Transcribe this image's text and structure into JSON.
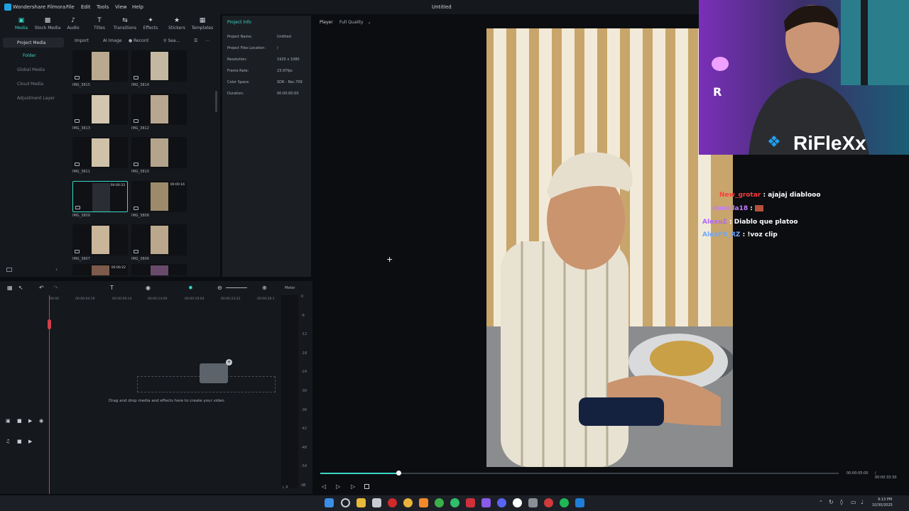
{
  "app": {
    "name": "Wondershare Filmora",
    "document_title": "Untitled",
    "menu": [
      "File",
      "Edit",
      "Tools",
      "View",
      "Help"
    ]
  },
  "toolbar": {
    "items": [
      {
        "label": "Media",
        "icon": "media-icon",
        "active": true
      },
      {
        "label": "Stock Media",
        "icon": "stock-media-icon"
      },
      {
        "label": "Audio",
        "icon": "audio-icon"
      },
      {
        "label": "Titles",
        "icon": "titles-icon"
      },
      {
        "label": "Transitions",
        "icon": "transitions-icon"
      },
      {
        "label": "Effects",
        "icon": "effects-icon"
      },
      {
        "label": "Stickers",
        "icon": "stickers-icon"
      },
      {
        "label": "Templates",
        "icon": "templates-icon"
      }
    ]
  },
  "leftnav": {
    "project_media": "Project Media",
    "folder": "Folder",
    "global_media": "Global Media",
    "cloud_media": "Cloud Media",
    "adjustment_layer": "Adjustment Layer"
  },
  "media_toolbar": {
    "import": "Import",
    "ai_image": "AI Image",
    "record": "Record",
    "search_placeholder": "Sea..."
  },
  "media_items": [
    {
      "name": "IMG_3815",
      "duration": ""
    },
    {
      "name": "IMG_3814",
      "duration": ""
    },
    {
      "name": "IMG_3813",
      "duration": ""
    },
    {
      "name": "IMG_3812",
      "duration": ""
    },
    {
      "name": "IMG_3811",
      "duration": ""
    },
    {
      "name": "IMG_3810",
      "duration": ""
    },
    {
      "name": "IMG_3809",
      "duration": "00:00:33",
      "selected": true
    },
    {
      "name": "IMG_3808",
      "duration": "00:00:16"
    },
    {
      "name": "IMG_3807",
      "duration": ""
    },
    {
      "name": "IMG_3806",
      "duration": ""
    },
    {
      "name": "",
      "duration": "00:00:22"
    },
    {
      "name": "",
      "duration": ""
    }
  ],
  "project_info": {
    "tab": "Project Info",
    "fields": [
      {
        "label": "Project Name:",
        "value": "Untitled"
      },
      {
        "label": "Project Files Location:",
        "value": "/"
      },
      {
        "label": "Resolution:",
        "value": "1920 x 1080"
      },
      {
        "label": "Frame Rate:",
        "value": "23.97fps"
      },
      {
        "label": "Color Space:",
        "value": "SDR - Rec.709"
      },
      {
        "label": "Duration:",
        "value": "00:00:00:00"
      }
    ]
  },
  "player": {
    "label": "Player",
    "quality": "Full Quality",
    "current_time": "00:00:05:00",
    "total_time": "/ 00:00:33:30",
    "progress": 0.15
  },
  "timeline": {
    "ticks": [
      "00:00",
      "00:00:04:19",
      "00:00:09:14",
      "00:00:14:09",
      "00:00:19:04",
      "00:00:23:23",
      "00:00:28:1"
    ],
    "meter_label": "Meter",
    "meter_values": [
      "0",
      "-6",
      "-12",
      "-18",
      "-24",
      "-30",
      "-36",
      "-42",
      "-48",
      "-54",
      "dB"
    ],
    "meter_lr": "L    R",
    "drop_hint": "Drag and drop media and effects here to create your video."
  },
  "stream_overlay": {
    "channel": "RiFleXx",
    "chat": [
      {
        "user": "New_grotar",
        "message": "ajajaj diablooo",
        "color": "#ff3b3b"
      },
      {
        "user": "dunella18",
        "message": "",
        "color": "#c27cff"
      },
      {
        "user": "AlexuZ",
        "message": "Diablo que platoo",
        "color": "#b066ff"
      },
      {
        "user": "AlexPR_RZ",
        "message": "!voz clip",
        "color": "#6fa8ff"
      }
    ]
  },
  "taskbar": {
    "time": "9:13 PM",
    "date": "10/30/2025"
  }
}
